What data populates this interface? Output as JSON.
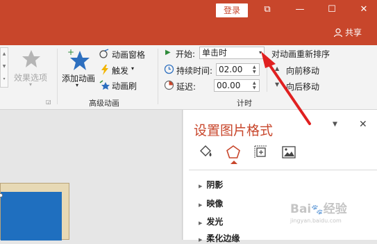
{
  "titlebar": {
    "login": "登录",
    "share": "共享"
  },
  "ribbon": {
    "effect_options": "效果选项",
    "add_animation": "添加动画",
    "animation_pane": "动画窗格",
    "trigger": "触发",
    "animation_painter": "动画刷",
    "advanced_group": "高级动画",
    "start_label": "开始:",
    "start_value": "单击时",
    "duration_label": "持续时间:",
    "duration_value": "02.00",
    "delay_label": "延迟:",
    "delay_value": "00.00",
    "timing_group": "计时",
    "reorder": "对动画重新排序",
    "move_earlier": "向前移动",
    "move_later": "向后移动"
  },
  "pane": {
    "title": "设置图片格式",
    "sections": [
      "阴影",
      "映像",
      "发光",
      "柔化边缘"
    ]
  },
  "colors": {
    "accent": "#c8462b",
    "ribbon_bg": "#f3f3f3",
    "annotation_arrow": "#e02020"
  },
  "watermark": "Bai 经验 jingyan.baidu.com"
}
